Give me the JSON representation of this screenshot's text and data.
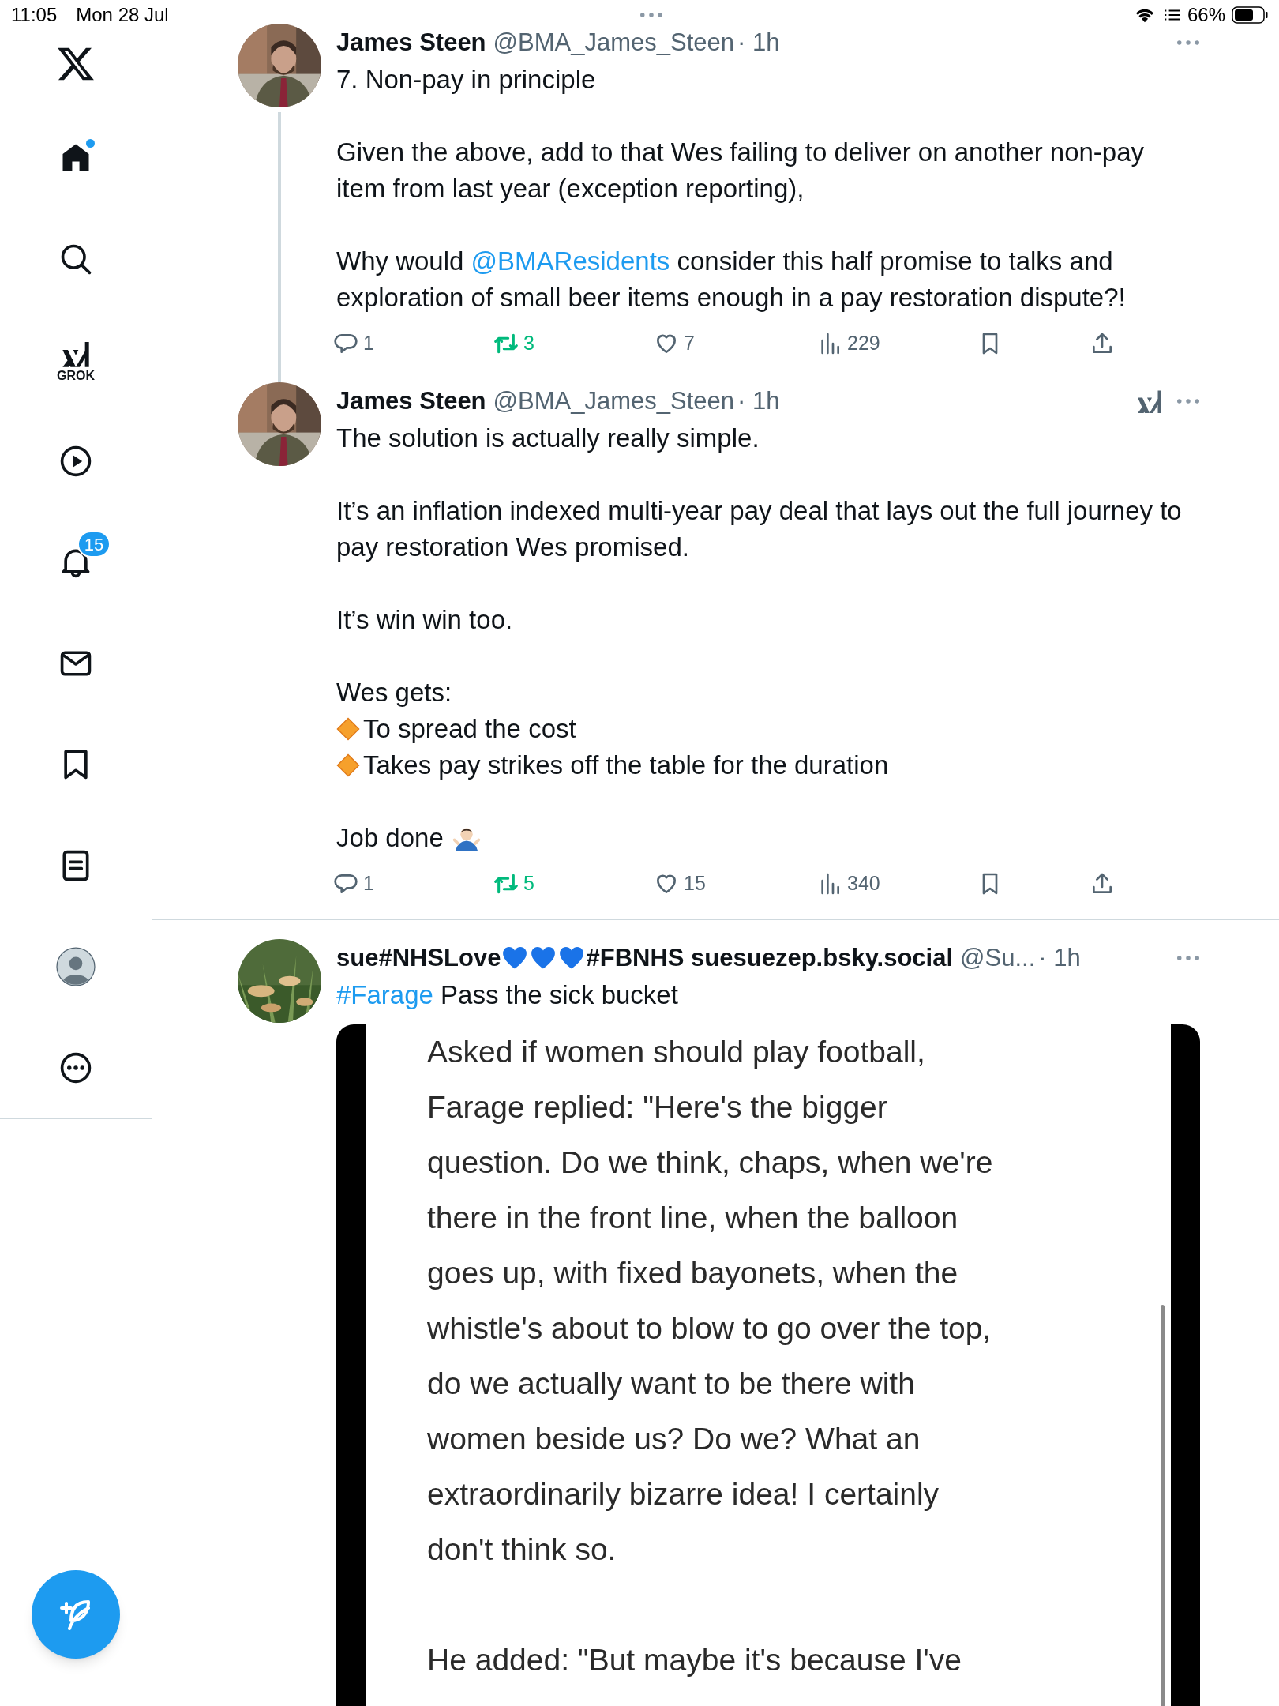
{
  "status_bar": {
    "time": "11:05",
    "date": "Mon 28 Jul",
    "battery": "66%"
  },
  "sidebar": {
    "items": [
      {
        "kind": "logo",
        "selected": false,
        "new_dot": false
      },
      {
        "kind": "home",
        "selected": true,
        "new_dot": true
      },
      {
        "kind": "search",
        "selected": false,
        "new_dot": false
      },
      {
        "kind": "grok",
        "selected": false,
        "new_dot": false,
        "label": "GROK"
      },
      {
        "kind": "video",
        "selected": false,
        "new_dot": false
      },
      {
        "kind": "notifications",
        "selected": false,
        "new_dot": false,
        "badge": "15"
      },
      {
        "kind": "messages",
        "selected": false,
        "new_dot": false
      },
      {
        "kind": "bookmarks",
        "selected": false,
        "new_dot": false
      },
      {
        "kind": "lists",
        "selected": false,
        "new_dot": false
      },
      {
        "kind": "profile",
        "selected": false,
        "new_dot": false
      },
      {
        "kind": "more",
        "selected": false,
        "new_dot": false
      }
    ]
  },
  "tweets": [
    {
      "name": "James Steen",
      "handle": "@BMA_James_Steen",
      "time": "· 1h",
      "thread_line": true,
      "grok_button": false,
      "paragraphs": [
        [
          {
            "kind": "text",
            "parts": [
              {
                "text": "7. Non-pay in principle",
                "link": false
              }
            ]
          }
        ],
        [
          {
            "kind": "text",
            "parts": [
              {
                "text": "Given the above, add to that Wes failing to deliver on another non-pay item from last year (exception reporting),",
                "link": false
              }
            ]
          }
        ],
        [
          {
            "kind": "text",
            "parts": [
              {
                "text": "Why would ",
                "link": false
              },
              {
                "text": "@BMAResidents",
                "link": true
              },
              {
                "text": " consider this half promise to talks and exploration of small beer items enough in a pay restoration dispute?!",
                "link": false
              }
            ]
          }
        ]
      ],
      "actions": [
        {
          "kind": "reply",
          "count": "1",
          "active": false
        },
        {
          "kind": "repost",
          "count": "3",
          "active": true
        },
        {
          "kind": "like",
          "count": "7",
          "active": false
        },
        {
          "kind": "views",
          "count": "229",
          "active": false
        },
        {
          "kind": "bookmark",
          "active": false
        },
        {
          "kind": "share"
        }
      ]
    },
    {
      "name": "James Steen",
      "handle": "@BMA_James_Steen",
      "time": "· 1h",
      "thread_line": false,
      "grok_button": true,
      "paragraphs": [
        [
          {
            "kind": "text",
            "parts": [
              {
                "text": "The solution is actually really simple.",
                "link": false
              }
            ]
          }
        ],
        [
          {
            "kind": "text",
            "parts": [
              {
                "text": "It’s an inflation indexed multi-year pay deal that lays out the full journey to pay restoration Wes promised.",
                "link": false
              }
            ]
          }
        ],
        [
          {
            "kind": "text",
            "parts": [
              {
                "text": "It’s win win too.",
                "link": false
              }
            ]
          }
        ],
        [
          {
            "kind": "text",
            "parts": [
              {
                "text": "Wes gets:",
                "link": false
              }
            ]
          },
          {
            "kind": "bullet",
            "parts": [
              {
                "text": "To spread the cost",
                "link": false
              }
            ]
          },
          {
            "kind": "bullet",
            "parts": [
              {
                "text": "Takes pay strikes off the table for the duration",
                "link": false
              }
            ]
          }
        ],
        [
          {
            "kind": "shrug",
            "parts": [
              {
                "text": "Job done",
                "link": false
              }
            ]
          }
        ]
      ],
      "actions": [
        {
          "kind": "reply",
          "count": "1",
          "active": false
        },
        {
          "kind": "repost",
          "count": "5",
          "active": true
        },
        {
          "kind": "like",
          "count": "15",
          "active": false
        },
        {
          "kind": "views",
          "count": "340",
          "active": false
        },
        {
          "kind": "bookmark",
          "active": false
        },
        {
          "kind": "share"
        }
      ]
    },
    {
      "name_parts": [
        {
          "kind": "text",
          "text": "sue#NHSLove"
        },
        {
          "kind": "heart"
        },
        {
          "kind": "heart"
        },
        {
          "kind": "heart"
        },
        {
          "kind": "text",
          "text": "#FBNHS suesuezep.bsky.social"
        }
      ],
      "handle": "@Su...",
      "time": "· 1h",
      "thread_line": false,
      "grok_button": false,
      "paragraphs": [
        [
          {
            "kind": "text",
            "parts": [
              {
                "text": "#Farage",
                "link": true
              },
              {
                "text": " Pass the sick bucket",
                "link": false
              }
            ]
          }
        ]
      ],
      "attachment": {
        "kind": "text_screenshot",
        "paragraphs": [
          [
            "Asked if women should play football,",
            "Farage replied: \"Here's the bigger",
            "question. Do we think, chaps, when we're",
            "there in the front line, when the balloon",
            "goes up, with fixed bayonets, when the",
            "whistle's about to blow to go over the top,",
            "do we actually want to be there with",
            "women beside us? Do we? What an",
            "extraordinarily bizarre idea! I certainly",
            "don't think so."
          ],
          [
            "He added: \"But maybe it's because I've"
          ]
        ]
      }
    }
  ]
}
